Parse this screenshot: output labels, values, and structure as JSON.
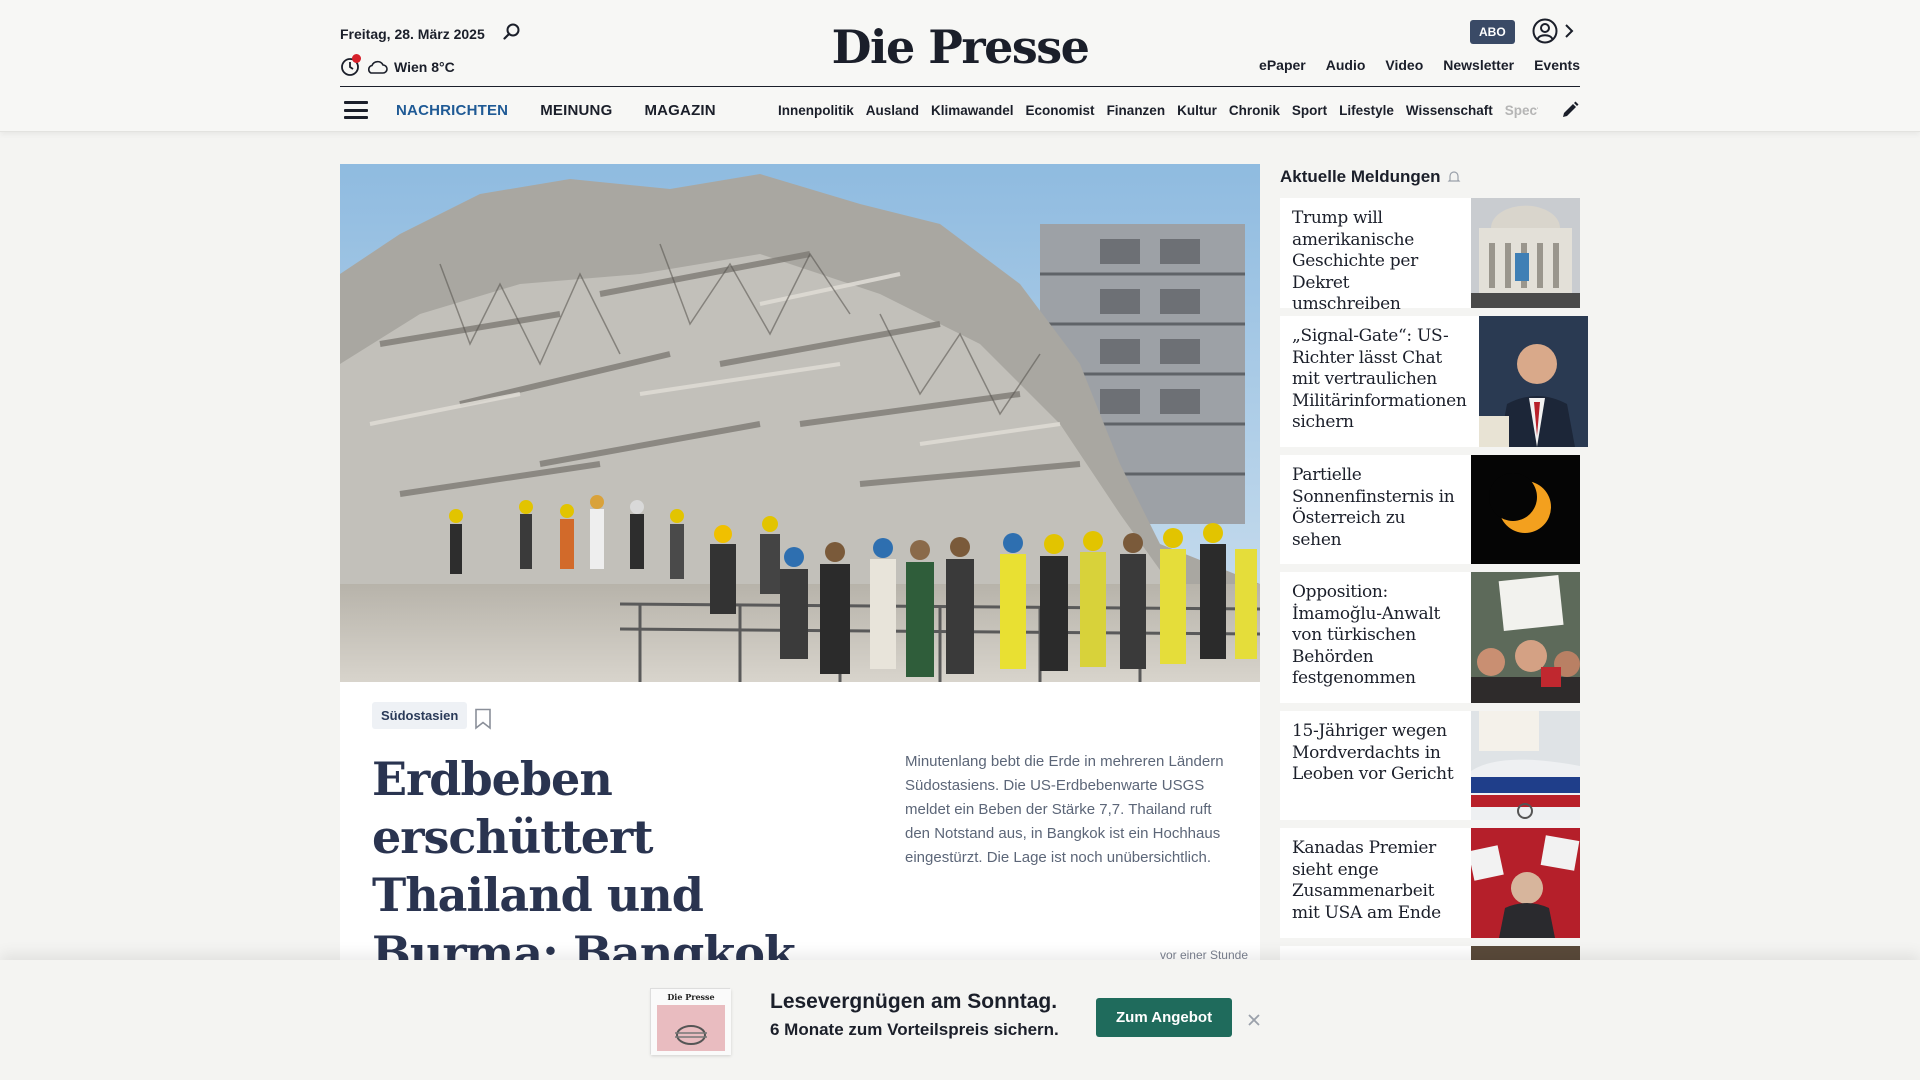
{
  "header": {
    "date": "Freitag, 28. März 2025",
    "weather": "Wien 8°C",
    "logo": "Die Presse",
    "abo_label": "ABO",
    "util_links": [
      "ePaper",
      "Audio",
      "Video",
      "Newsletter",
      "Events"
    ]
  },
  "nav": {
    "main": [
      "NACHRICHTEN",
      "MEINUNG",
      "MAGAZIN"
    ],
    "active": "NACHRICHTEN",
    "sections": [
      "Innenpolitik",
      "Ausland",
      "Klimawandel",
      "Economist",
      "Finanzen",
      "Kultur",
      "Chronik",
      "Sport",
      "Lifestyle",
      "Wissenschaft",
      "Spectr"
    ]
  },
  "hero": {
    "tag": "Südostasien",
    "headline": "Erdbeben erschüttert Thailand und Burma: Bangkok ruft Notstand aus",
    "lead": "Minutenlang bebt die Erde in mehreren Ländern Südostasiens. Die US-Erdbebenwarte USGS meldet ein Beben der Stärke 7,7. Thailand ruft den Notstand aus, in Bangkok ist ein Hochhaus eingestürzt. Die Lage ist noch unübersichtlich.",
    "timestamp": "vor einer Stunde"
  },
  "sidebar": {
    "title": "Aktuelle Meldungen",
    "items": [
      {
        "text": "Trump will amerikanische Geschichte per Dekret umschreiben"
      },
      {
        "text": "„Signal-Gate“: US-Richter lässt Chat mit vertraulichen Militärinformationen sichern"
      },
      {
        "text": "Partielle Sonnenfinsternis in Österreich zu sehen"
      },
      {
        "text": "Opposition: İmamoğlu-Anwalt von türkischen Behörden festgenommen"
      },
      {
        "text": "15-Jähriger wegen Mordverdachts in Leoben vor Gericht"
      },
      {
        "text": "Kanadas Premier sieht enge Zusammenarbeit mit USA am Ende"
      }
    ]
  },
  "promo": {
    "headline": "Lesevergnügen am Sonntag.",
    "subline": "6 Monate zum Vorteilspreis sichern.",
    "button": "Zum Angebot",
    "thumb_logo": "Die Presse"
  },
  "colors": {
    "accent_nav": "#1f5a95",
    "abo_bg": "#3a4a66",
    "cta_bg": "#1f6b5c",
    "notification_dot": "#d6202a"
  }
}
